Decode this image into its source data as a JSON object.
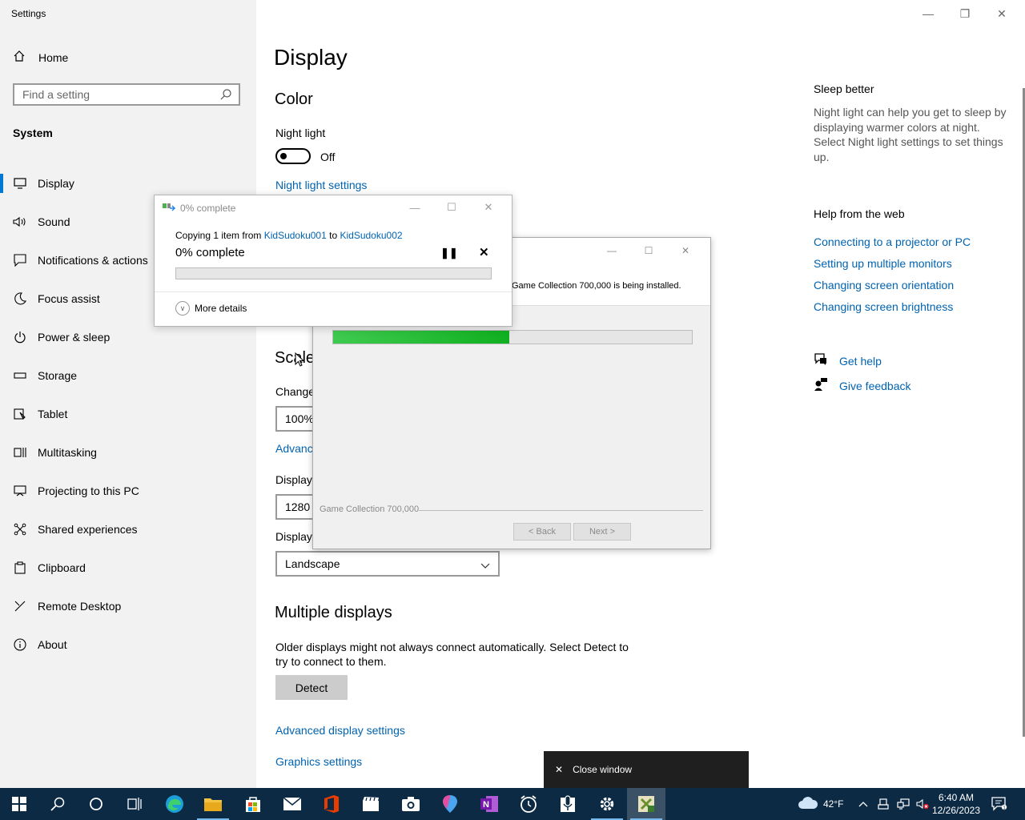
{
  "app": {
    "title": "Settings"
  },
  "sidebar": {
    "home_label": "Home",
    "search_placeholder": "Find a setting",
    "section_label": "System",
    "items": [
      {
        "label": "Display",
        "icon": "monitor-icon"
      },
      {
        "label": "Sound",
        "icon": "speaker-icon"
      },
      {
        "label": "Notifications & actions",
        "icon": "notification-icon"
      },
      {
        "label": "Focus assist",
        "icon": "moon-icon"
      },
      {
        "label": "Power & sleep",
        "icon": "power-icon"
      },
      {
        "label": "Storage",
        "icon": "storage-icon"
      },
      {
        "label": "Tablet",
        "icon": "tablet-icon"
      },
      {
        "label": "Multitasking",
        "icon": "multitasking-icon"
      },
      {
        "label": "Projecting to this PC",
        "icon": "projecting-icon"
      },
      {
        "label": "Shared experiences",
        "icon": "shared-icon"
      },
      {
        "label": "Clipboard",
        "icon": "clipboard-icon"
      },
      {
        "label": "Remote Desktop",
        "icon": "remote-desktop-icon"
      },
      {
        "label": "About",
        "icon": "info-icon"
      }
    ]
  },
  "main": {
    "title": "Display",
    "color_heading": "Color",
    "night_light_label": "Night light",
    "night_light_state": "Off",
    "night_light_settings_link": "Night light settings",
    "scale_heading": "Scale",
    "change_label": "Change",
    "scale_value": "100%",
    "advanced_link": "Advanc",
    "display_label_1": "Display",
    "resolution_value": "1280",
    "display_label_2": "Display",
    "orientation_value": "Landscape",
    "multiple_heading": "Multiple displays",
    "multiple_text_1": "Older displays might not always connect automatically. Select Detect to",
    "multiple_text_2": "try to connect to them.",
    "detect_label": "Detect",
    "advanced_display_link": "Advanced display settings",
    "graphics_link": "Graphics settings"
  },
  "right": {
    "sleep_heading": "Sleep better",
    "sleep_text": "Night light can help you get to sleep by displaying warmer colors at night. Select Night light settings to set things up.",
    "help_heading": "Help from the web",
    "links": [
      "Connecting to a projector or PC",
      "Setting up multiple monitors",
      "Changing screen orientation",
      "Changing screen brightness"
    ],
    "get_help": "Get help",
    "give_feedback": "Give feedback"
  },
  "copy_dialog": {
    "title": "0% complete",
    "line_prefix": "Copying 1 item from ",
    "source": "KidSudoku001",
    "to": " to ",
    "destination": "KidSudoku002",
    "percent_label": "0% complete",
    "progress": 0,
    "more_details": "More details"
  },
  "installer": {
    "message": "Game Collection 700,000 is being installed.",
    "progress": 0.49,
    "brand": "Game Collection 700,000",
    "back_label": "< Back",
    "next_label": "Next >"
  },
  "tooltip": {
    "close_window": "Close window"
  },
  "taskbar": {
    "weather": "42°F",
    "time": "6:40 AM",
    "date": "12/26/2023"
  },
  "colors": {
    "accent": "#0078d4",
    "link": "#0063b1",
    "taskbar": "#0c2a44",
    "progress_green": "#06b025"
  }
}
